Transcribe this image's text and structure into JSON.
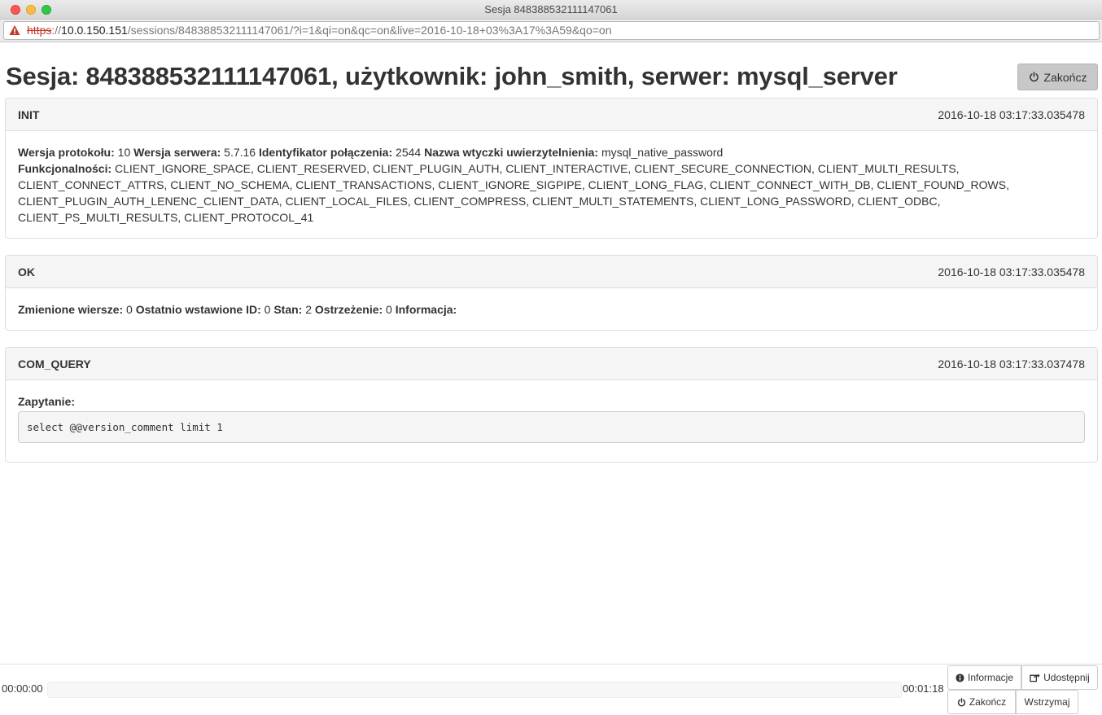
{
  "window": {
    "title": "Sesja 848388532111147061"
  },
  "url": {
    "scheme": "https",
    "separator": "://",
    "host": "10.0.150.151",
    "path": "/sessions/848388532111147061/?i=1&qi=on&qc=on&live=2016-10-18+03%3A17%3A59&qo=on"
  },
  "header": {
    "title": "Sesja: 848388532111147061, użytkownik: john_smith, serwer: mysql_server",
    "end_label": "Zakończ"
  },
  "packets": [
    {
      "type": "INIT",
      "time": "2016-10-18 03:17:33.035478",
      "protocol_label": "Wersja protokołu:",
      "protocol_value": "10",
      "server_label": "Wersja serwera:",
      "server_value": "5.7.16",
      "conn_label": "Identyfikator połączenia:",
      "conn_value": "2544",
      "auth_label": "Nazwa wtyczki uwierzytelnienia:",
      "auth_value": "mysql_native_password",
      "caps_label": "Funkcjonalności:",
      "caps_value": "CLIENT_IGNORE_SPACE, CLIENT_RESERVED, CLIENT_PLUGIN_AUTH, CLIENT_INTERACTIVE, CLIENT_SECURE_CONNECTION, CLIENT_MULTI_RESULTS, CLIENT_CONNECT_ATTRS, CLIENT_NO_SCHEMA, CLIENT_TRANSACTIONS, CLIENT_IGNORE_SIGPIPE, CLIENT_LONG_FLAG, CLIENT_CONNECT_WITH_DB, CLIENT_FOUND_ROWS, CLIENT_PLUGIN_AUTH_LENENC_CLIENT_DATA, CLIENT_LOCAL_FILES, CLIENT_COMPRESS, CLIENT_MULTI_STATEMENTS, CLIENT_LONG_PASSWORD, CLIENT_ODBC, CLIENT_PS_MULTI_RESULTS, CLIENT_PROTOCOL_41"
    },
    {
      "type": "OK",
      "time": "2016-10-18 03:17:33.035478",
      "rows_label": "Zmienione wiersze:",
      "rows_value": "0",
      "insert_label": "Ostatnio wstawione ID:",
      "insert_value": "0",
      "status_label": "Stan:",
      "status_value": "2",
      "warn_label": "Ostrzeżenie:",
      "warn_value": "0",
      "info_label": "Informacja:",
      "info_value": ""
    },
    {
      "type": "COM_QUERY",
      "time": "2016-10-18 03:17:33.037478",
      "query_label": "Zapytanie:",
      "query_value": "select @@version_comment limit 1"
    }
  ],
  "player": {
    "time_start": "00:00:00",
    "time_end": "00:01:18",
    "info_label": "Informacje",
    "share_label": "Udostępnij",
    "end_label": "Zakończ",
    "pause_label": "Wstrzymaj"
  },
  "icons": {
    "warning": "warning-triangle-icon",
    "power": "power-icon",
    "info": "info-circle-icon",
    "share": "share-icon"
  },
  "colors": {
    "warning": "#c0392b",
    "panel_head": "#f5f5f5",
    "end_button": "#c8c8c8"
  }
}
